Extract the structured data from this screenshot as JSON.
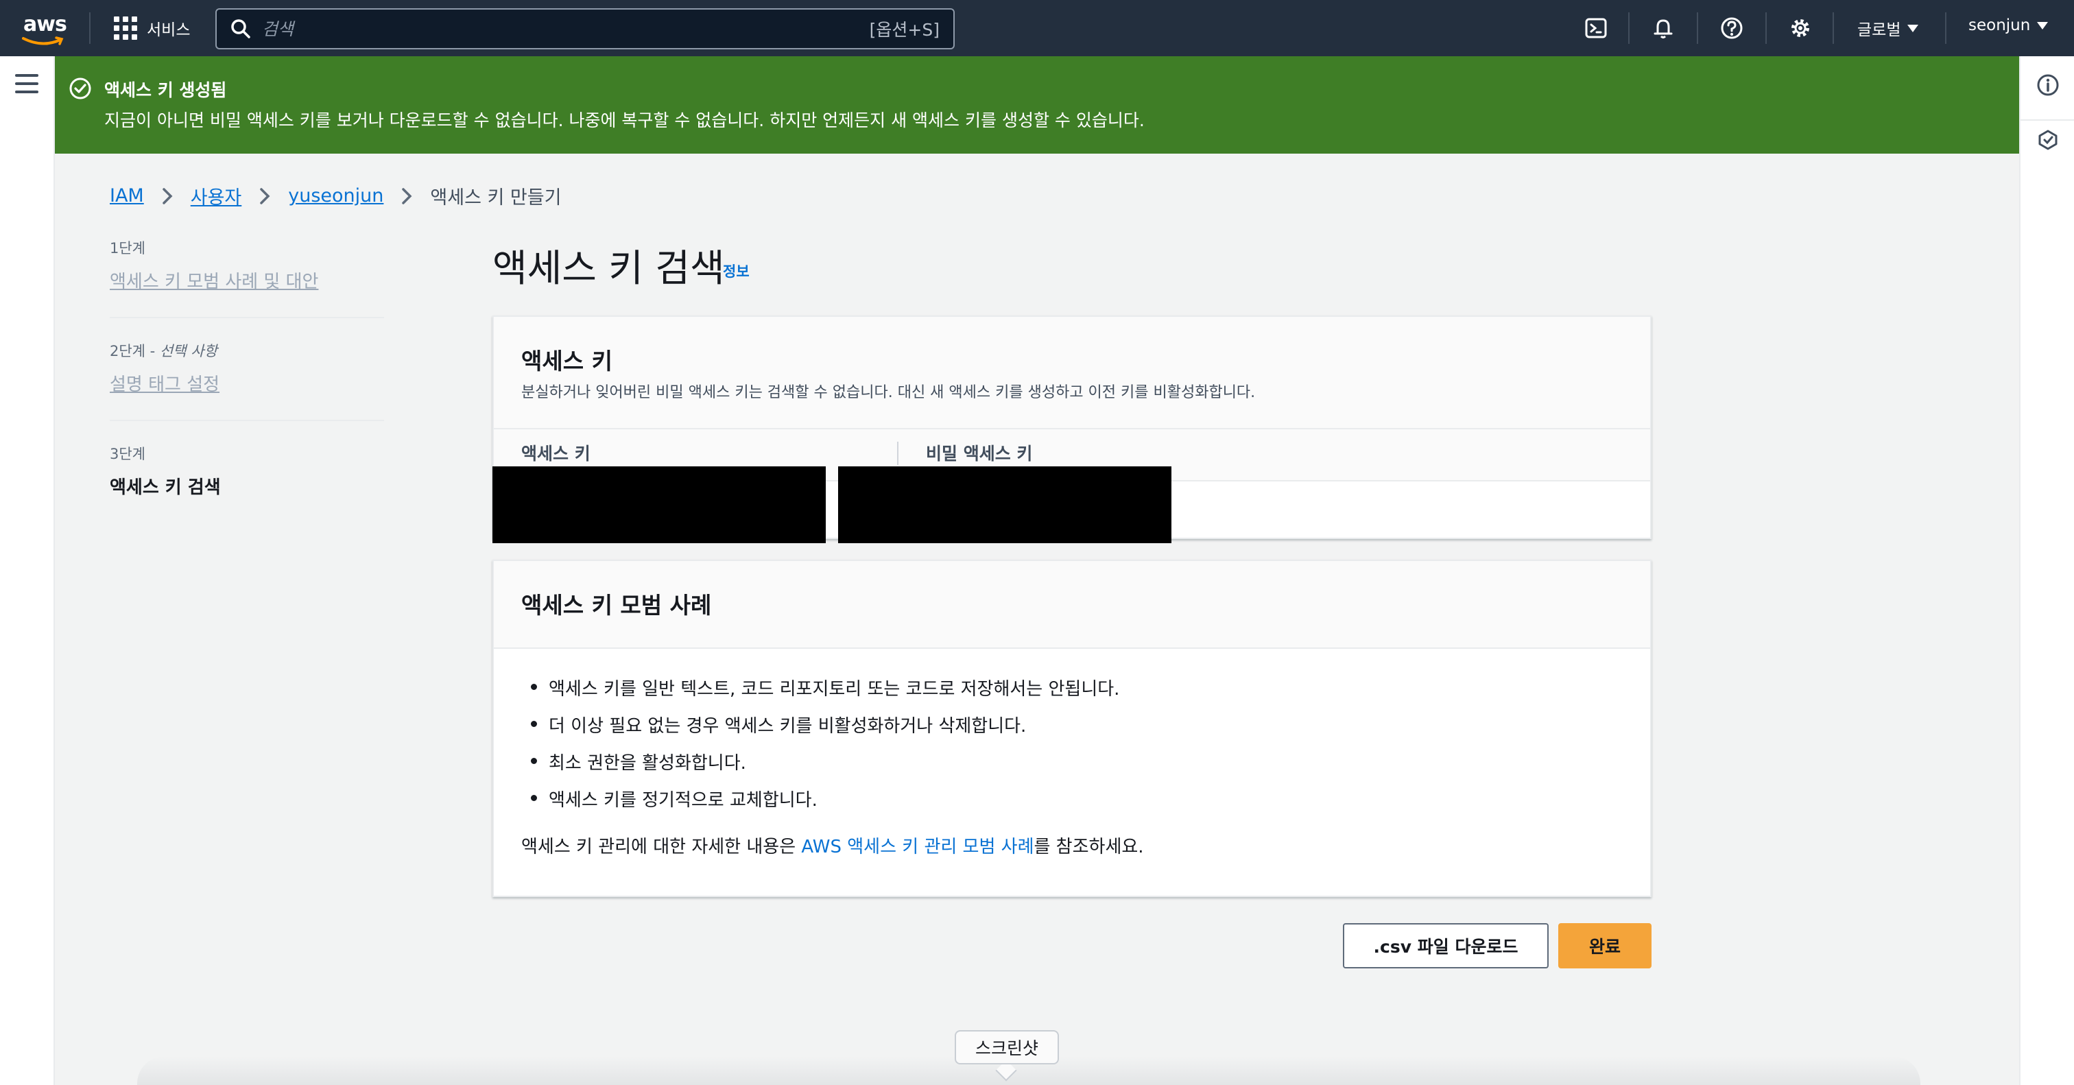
{
  "topnav": {
    "logo_text": "aws",
    "services_label": "서비스",
    "search_placeholder": "검색",
    "search_shortcut": "[옵션+S]",
    "region_label": "글로벌",
    "user_label": "seonjun",
    "icons": [
      "cloudshell-icon",
      "notifications-icon",
      "help-icon",
      "settings-icon"
    ]
  },
  "flash": {
    "status": "success",
    "title": "액세스 키 생성됨",
    "message": "지금이 아니면 비밀 액세스 키를 보거나 다운로드할 수 없습니다. 나중에 복구할 수 없습니다. 하지만 언제든지 새 액세스 키를 생성할 수 있습니다."
  },
  "breadcrumb": {
    "items": [
      "IAM",
      "사용자",
      "yuseonjun"
    ],
    "current": "액세스 키 만들기"
  },
  "steps": [
    {
      "number": "1단계",
      "label": "액세스 키 모범 사례 및 대안"
    },
    {
      "number": "2단계 - ",
      "optional": "선택 사항",
      "label": "설명 태그 설정"
    },
    {
      "number": "3단계",
      "label": "액세스 키 검색"
    }
  ],
  "page": {
    "title": "액세스 키 검색",
    "info_link": "정보"
  },
  "access_keys": {
    "heading": "액세스 키",
    "description": "분실하거나 잊어버린 비밀 액세스 키는 검색할 수 없습니다. 대신 새 액세스 키를 생성하고 이전 키를 비활성화합니다.",
    "columns": [
      "액세스 키",
      "비밀 액세스 키"
    ]
  },
  "best_practices": {
    "heading": "액세스 키 모범 사례",
    "items": [
      "액세스 키를 일반 텍스트, 코드 리포지토리 또는 코드로 저장해서는 안됩니다.",
      "더 이상 필요 없는 경우 액세스 키를 비활성화하거나 삭제합니다.",
      "최소 권한을 활성화합니다.",
      "액세스 키를 정기적으로 교체합니다."
    ],
    "more_prefix": "액세스 키 관리에 대한 자세한 내용은 ",
    "more_link": "AWS 액세스 키 관리 모범 사례",
    "more_suffix": "를 참조하세요."
  },
  "actions": {
    "csv_label": ".csv 파일 다운로드",
    "done_label": "완료"
  },
  "tooltip": "스크린샷",
  "colors": {
    "nav_bg": "#232f3e",
    "success_bg": "#3f7e26",
    "link": "#0972d3",
    "primary_button": "#f4a43a"
  }
}
